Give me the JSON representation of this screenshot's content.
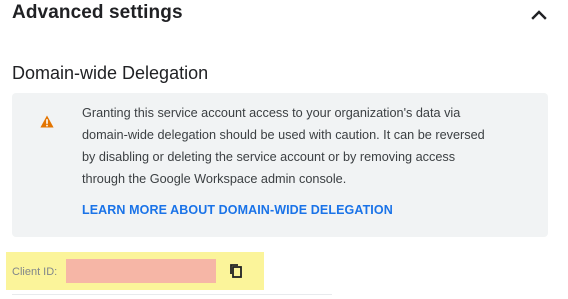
{
  "advanced": {
    "title": "Advanced settings",
    "toggle_icon": "chevron-up-icon"
  },
  "delegation": {
    "section_title": "Domain-wide Delegation",
    "warning_icon": "warning-icon",
    "warning_color": "#e37400",
    "warning_lines": [
      "Granting this service account access to your organization's data via",
      "domain-wide delegation should be used with caution. It can be reversed",
      "by disabling or deleting the service account or by removing access",
      "through the Google Workspace admin console."
    ],
    "learn_more": "LEARN MORE ABOUT DOMAIN-WIDE DELEGATION",
    "link_color": "#1a73e8"
  },
  "client": {
    "label": "Client ID:",
    "copy_icon": "copy-icon",
    "highlight_color": "#fbf49a",
    "redaction_color": "#f6b6a6"
  }
}
